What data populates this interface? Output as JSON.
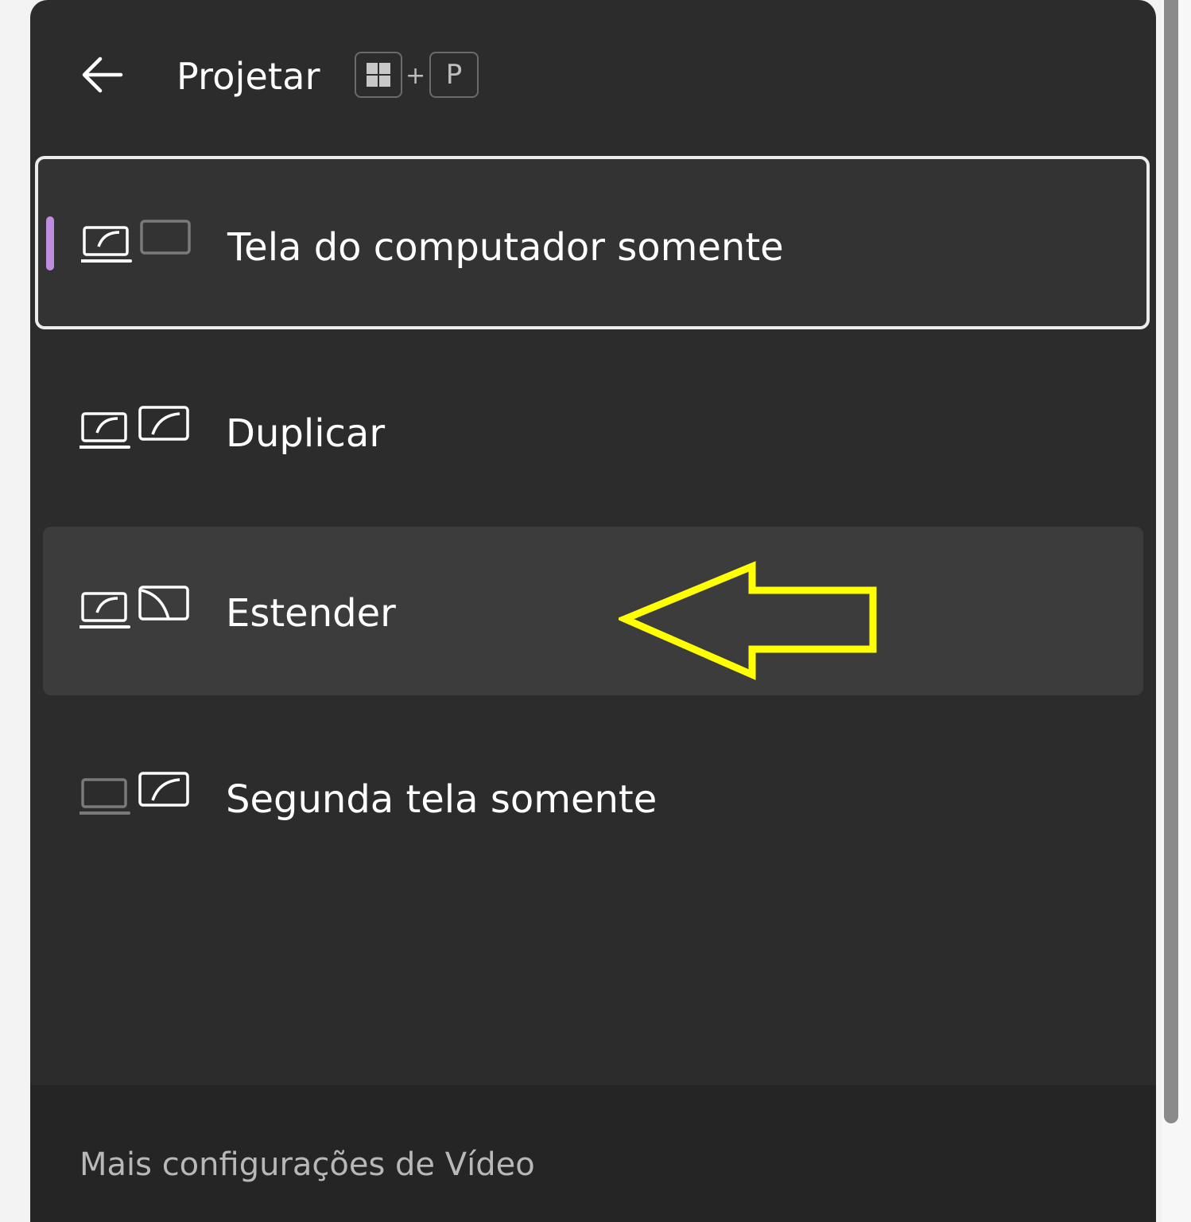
{
  "header": {
    "title": "Projetar",
    "shortcut": {
      "key1": "windows-logo",
      "plus": "+",
      "key2": "P"
    }
  },
  "options": [
    {
      "label": "Tela do computador somente",
      "icon": "pc-screen-only-icon",
      "state": "selected"
    },
    {
      "label": "Duplicar",
      "icon": "duplicate-icon",
      "state": "normal"
    },
    {
      "label": "Estender",
      "icon": "extend-icon",
      "state": "hovered"
    },
    {
      "label": "Segunda tela somente",
      "icon": "second-screen-only-icon",
      "state": "normal"
    }
  ],
  "footer": {
    "link": "Mais configurações de Vídeo"
  },
  "colors": {
    "panel": "#2c2c2c",
    "footer": "#252525",
    "accent": "#c08ee0",
    "annotation": "#ffff00"
  }
}
